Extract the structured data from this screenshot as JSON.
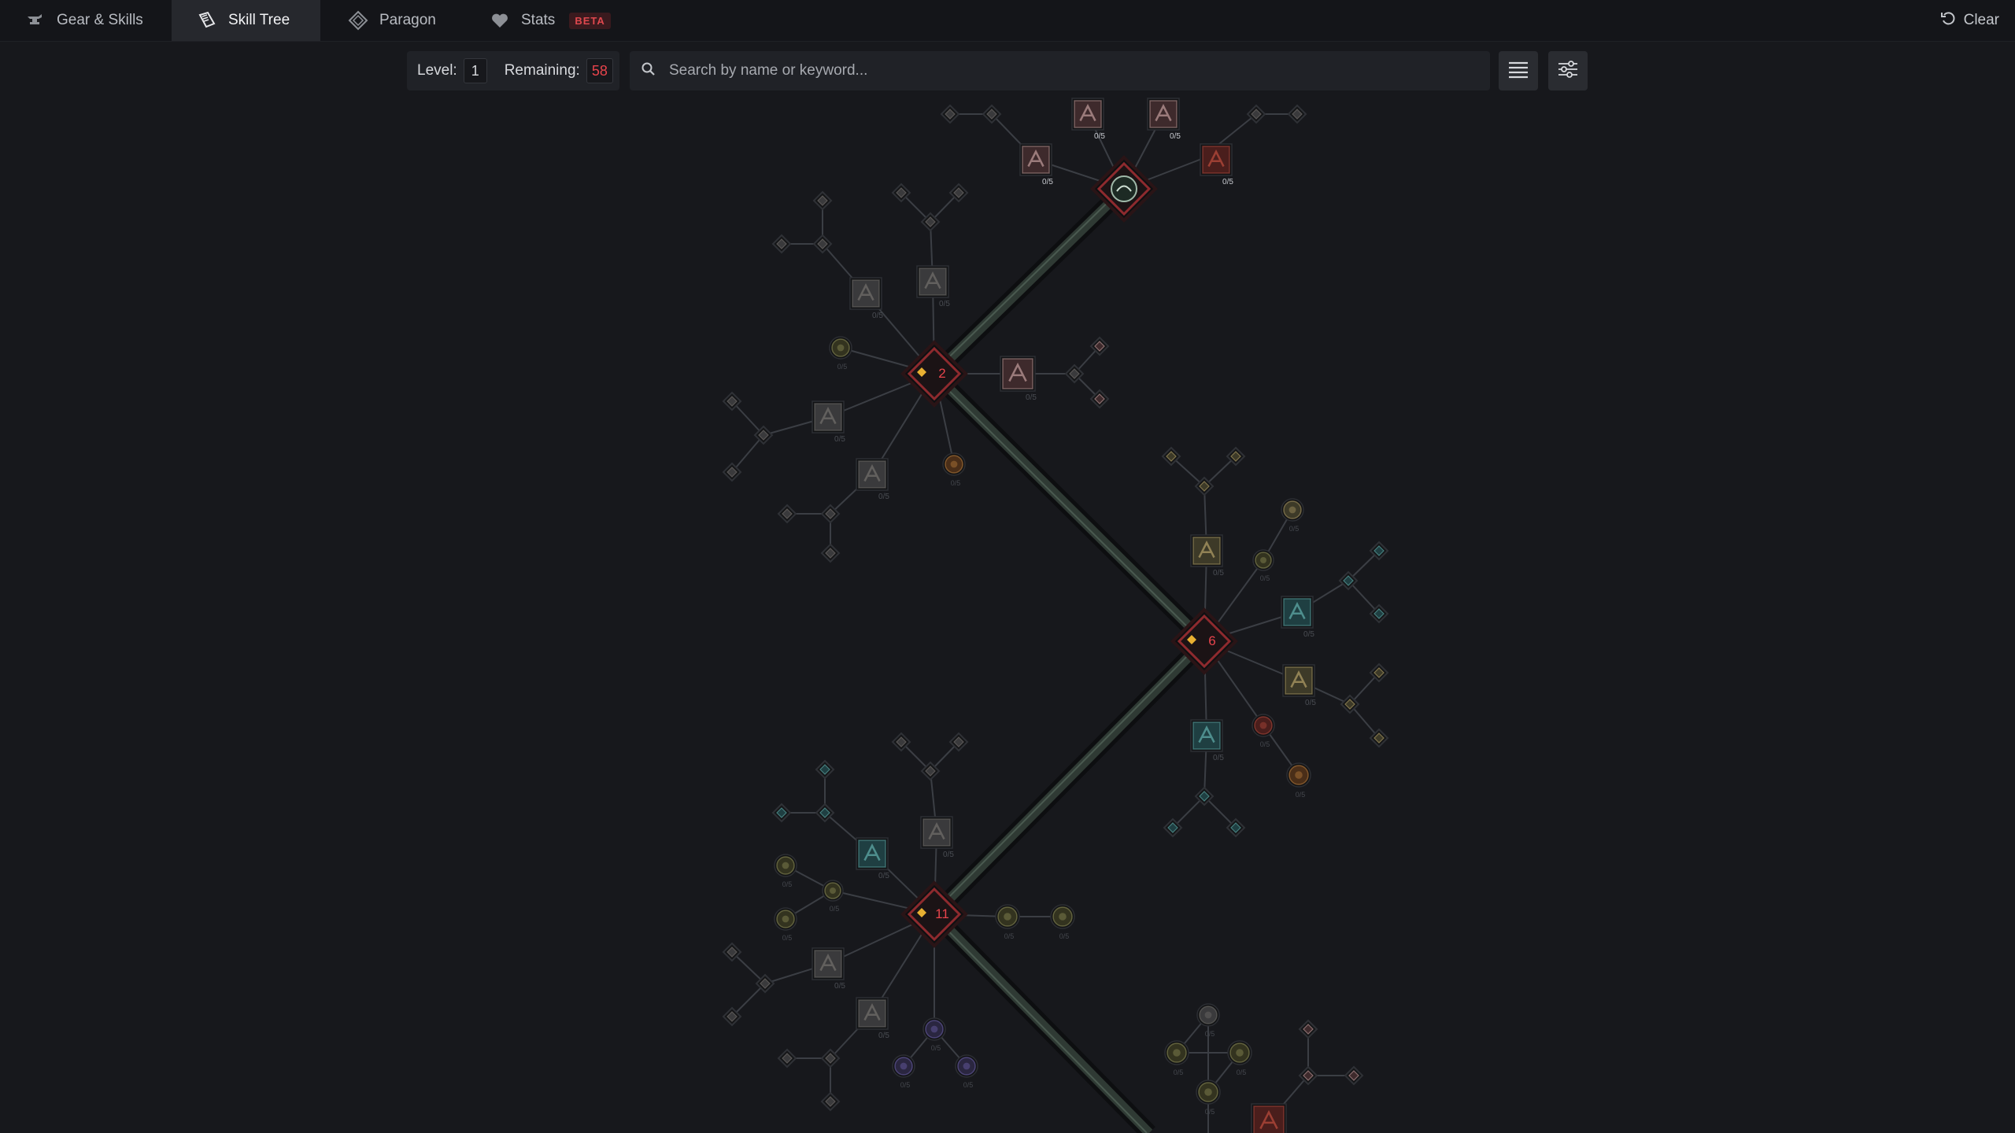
{
  "nav": {
    "tabs": [
      {
        "label": "Gear & Skills",
        "icon": "anvil-icon"
      },
      {
        "label": "Skill Tree",
        "icon": "book-icon",
        "active": true
      },
      {
        "label": "Paragon",
        "icon": "paragon-icon"
      },
      {
        "label": "Stats",
        "icon": "heart-icon",
        "badge": "BETA"
      }
    ],
    "clear_label": "Clear"
  },
  "toolbar": {
    "level_label": "Level:",
    "level_value": "1",
    "remaining_label": "Remaining:",
    "remaining_value": "58",
    "search_placeholder": "Search by name or keyword..."
  },
  "tree": {
    "hubs": [
      {
        "id": "hub-basic",
        "requirement": ""
      },
      {
        "id": "hub-core",
        "requirement": "2"
      },
      {
        "id": "hub-defensive",
        "requirement": "6"
      },
      {
        "id": "hub-conjuration",
        "requirement": "11"
      }
    ],
    "rank_label": "0/5"
  },
  "colors": {
    "accent_red": "#e8444c",
    "hub_border": "#8e2a2e",
    "trunk": "#2f3a34"
  }
}
